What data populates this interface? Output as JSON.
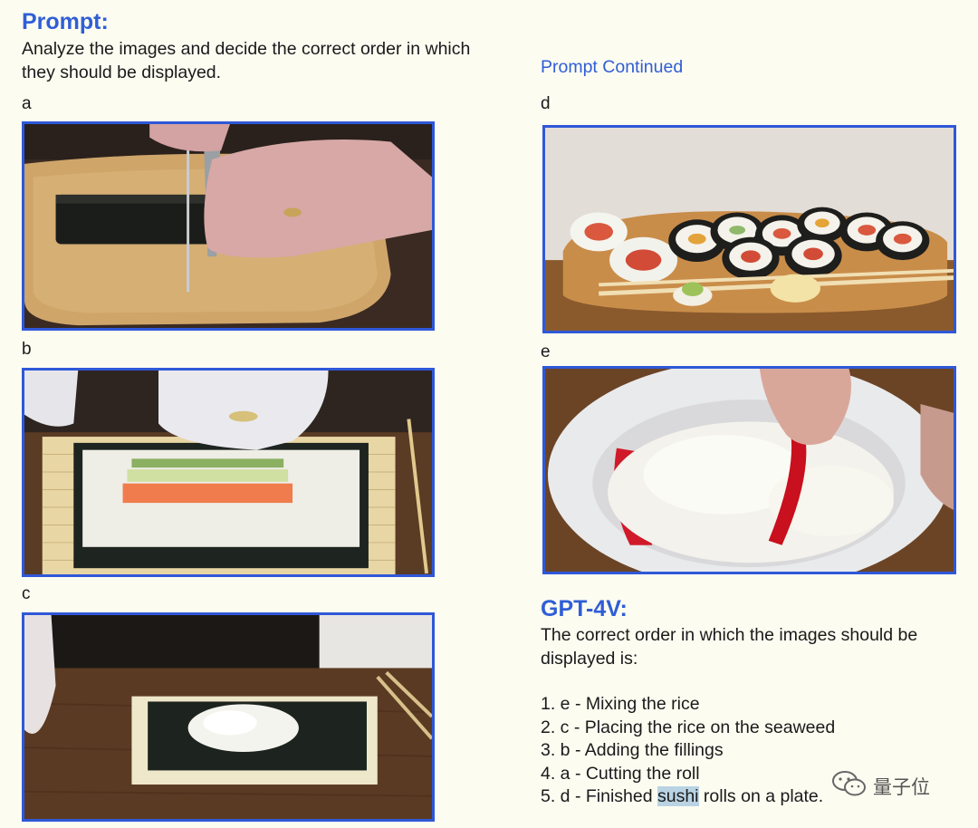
{
  "left": {
    "heading": "Prompt:",
    "instruction": "Analyze the images and decide the correct order in which they should be displayed.",
    "images": [
      {
        "label": "a",
        "icon": "cutting-roll-photo"
      },
      {
        "label": "b",
        "icon": "adding-fillings-photo"
      },
      {
        "label": "c",
        "icon": "rice-on-seaweed-photo"
      }
    ]
  },
  "right": {
    "continued": "Prompt Continued",
    "images": [
      {
        "label": "d",
        "icon": "sushi-plate-photo"
      },
      {
        "label": "e",
        "icon": "mixing-rice-photo"
      }
    ],
    "answer_heading": "GPT-4V:",
    "answer_intro": "The correct order in which the images should be displayed is:",
    "steps": [
      "1. e - Mixing the rice",
      "2. c - Placing the rice on the seaweed",
      "3. b - Adding the fillings",
      "4. a - Cutting the roll"
    ],
    "last_step": {
      "prefix": "5. d - Finished ",
      "highlight": "sushi",
      "suffix": " rolls on a plate."
    }
  },
  "watermark": {
    "text": "量子位",
    "icon": "wechat-icon"
  }
}
